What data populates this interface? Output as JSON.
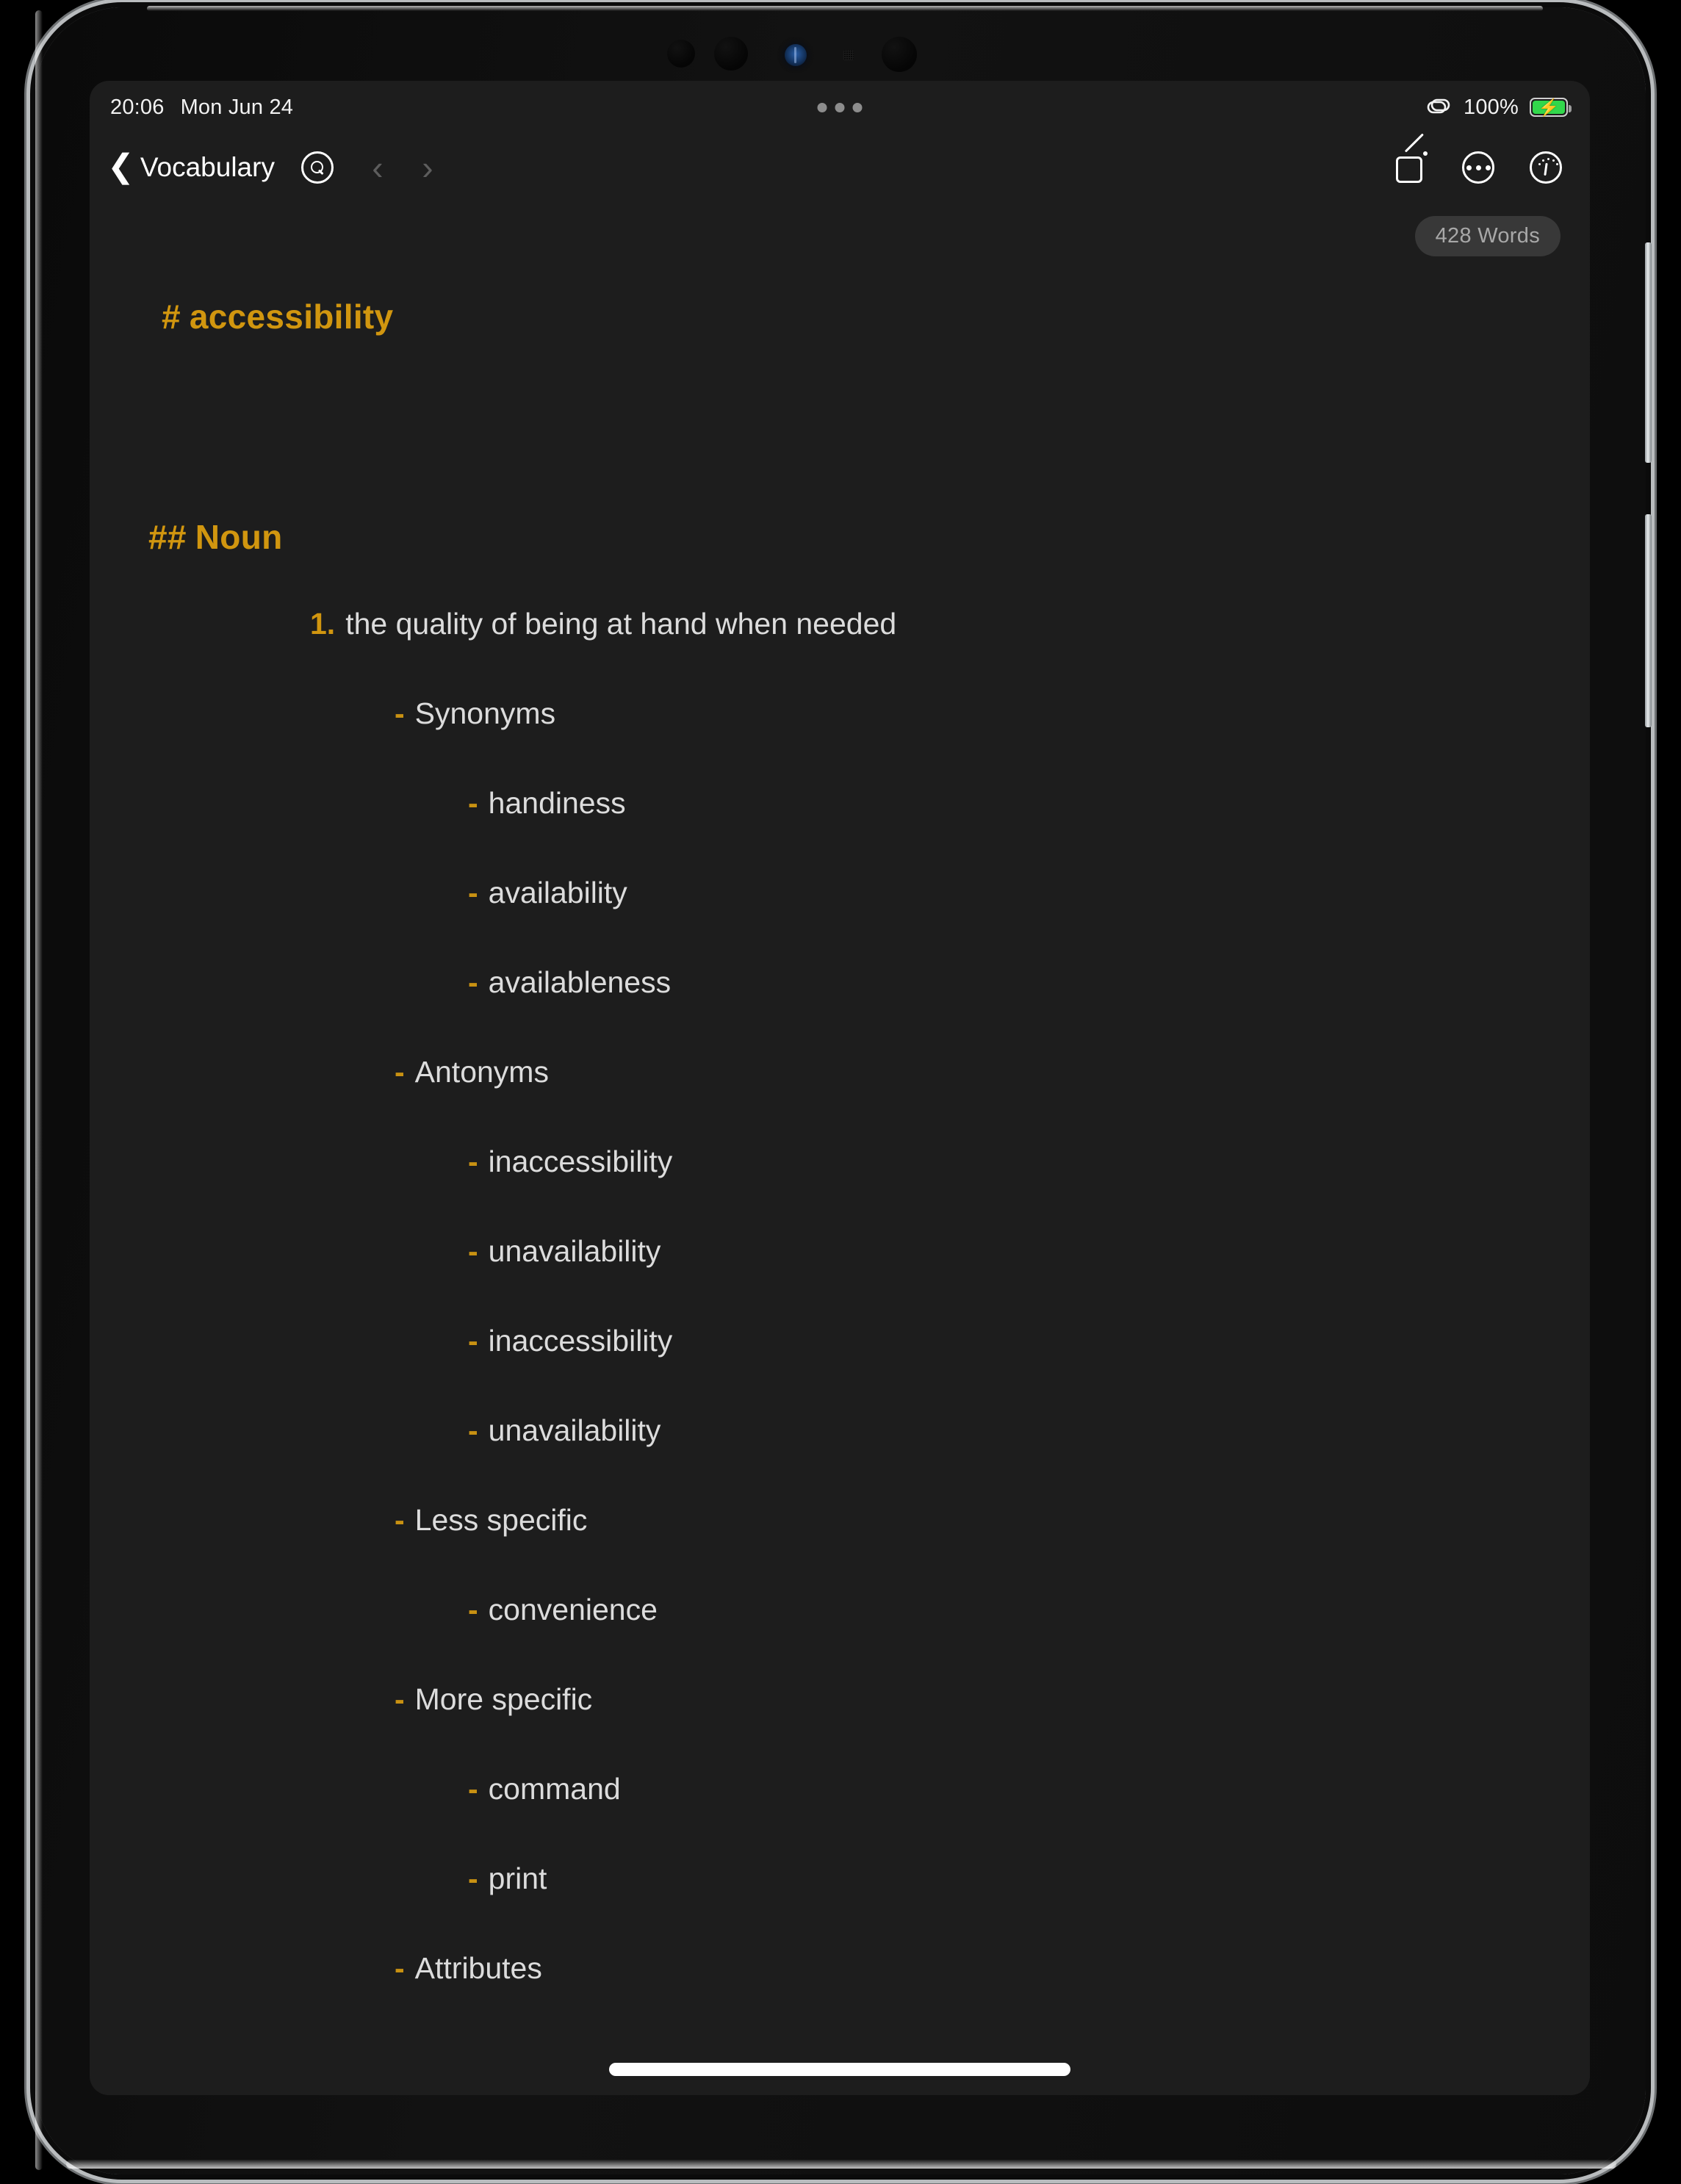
{
  "status_bar": {
    "time": "20:06",
    "date": "Mon Jun 24",
    "battery_percent": "100%",
    "battery_bolt": "⚡",
    "link_icon": "link-icon",
    "multitask_dots": "multitasking-handle"
  },
  "nav_bar": {
    "back_chevron": "❮",
    "back_label": "Vocabulary",
    "search_icon": "search-icon",
    "prev_arrow": "‹",
    "next_arrow": "›",
    "compose_icon": "compose-icon",
    "more_icon": "more-ellipsis-icon",
    "info_icon": "info-gauge-icon"
  },
  "word_count": "428 Words",
  "colors": {
    "accent": "#d1960f",
    "bullet": "#c89112",
    "body_text": "#dcdcdc",
    "screen_bg": "#1d1d1d",
    "badge_bg": "#383838",
    "badge_text": "#a8a8a8",
    "battery_green": "#32d74b"
  },
  "document": {
    "h1": {
      "marker": "#",
      "text": "accessibility"
    },
    "h2": {
      "marker": "##",
      "text": "Noun"
    },
    "entries": [
      {
        "bullet": "1.",
        "text": "the quality of being at hand when needed",
        "level": 0,
        "kind": "numbered"
      },
      {
        "bullet": "-",
        "text": "Synonyms",
        "level": 1,
        "kind": "bullet"
      },
      {
        "bullet": "-",
        "text": "handiness",
        "level": 2,
        "kind": "bullet"
      },
      {
        "bullet": "-",
        "text": "availability",
        "level": 2,
        "kind": "bullet"
      },
      {
        "bullet": "-",
        "text": "availableness",
        "level": 2,
        "kind": "bullet"
      },
      {
        "bullet": "-",
        "text": "Antonyms",
        "level": 1,
        "kind": "bullet"
      },
      {
        "bullet": "-",
        "text": "inaccessibility",
        "level": 2,
        "kind": "bullet"
      },
      {
        "bullet": "-",
        "text": "unavailability",
        "level": 2,
        "kind": "bullet"
      },
      {
        "bullet": "-",
        "text": "inaccessibility",
        "level": 2,
        "kind": "bullet"
      },
      {
        "bullet": "-",
        "text": "unavailability",
        "level": 2,
        "kind": "bullet"
      },
      {
        "bullet": "-",
        "text": "Less specific",
        "level": 1,
        "kind": "bullet"
      },
      {
        "bullet": "-",
        "text": "convenience",
        "level": 2,
        "kind": "bullet"
      },
      {
        "bullet": "-",
        "text": "More specific",
        "level": 1,
        "kind": "bullet"
      },
      {
        "bullet": "-",
        "text": "command",
        "level": 2,
        "kind": "bullet"
      },
      {
        "bullet": "-",
        "text": "print",
        "level": 2,
        "kind": "bullet"
      },
      {
        "bullet": "-",
        "text": "Attributes",
        "level": 1,
        "kind": "bullet"
      }
    ]
  },
  "home_indicator": "home-indicator"
}
